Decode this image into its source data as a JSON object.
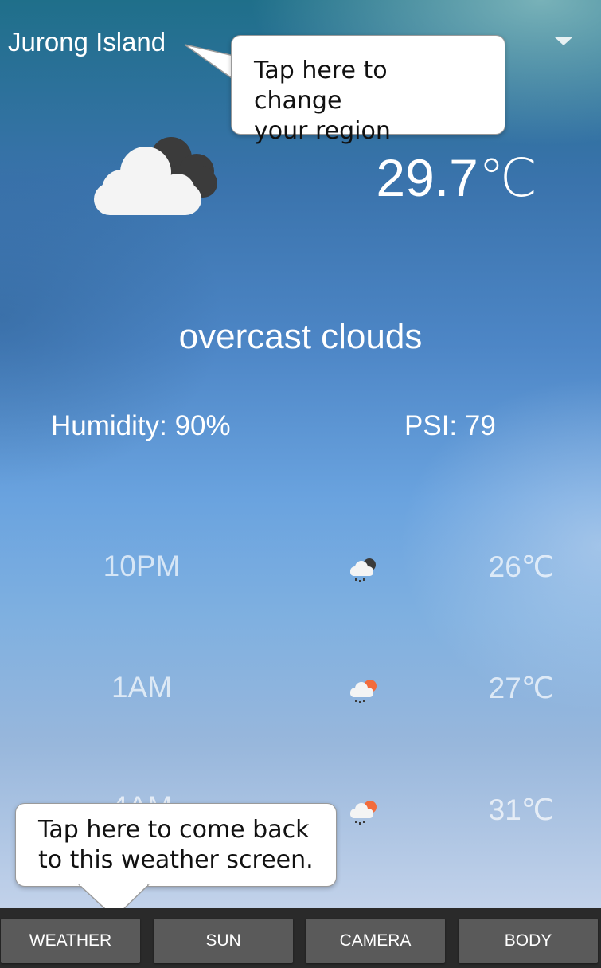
{
  "header": {
    "region": "Jurong Island"
  },
  "current": {
    "icon": "cloud-dark-cloud-icon",
    "temperature": "29.7℃",
    "description": "overcast clouds",
    "humidity": "Humidity: 90%",
    "psi": "PSI: 79"
  },
  "forecast": [
    {
      "time": "10PM",
      "icon": "night-rain-cloud-icon",
      "temp": "26℃"
    },
    {
      "time": "1AM",
      "icon": "sun-rain-cloud-icon",
      "temp": "27℃"
    },
    {
      "time": "4AM",
      "icon": "sun-rain-cloud-icon",
      "temp": "31℃"
    }
  ],
  "tooltips": {
    "region": "Tap here to change\nyour region",
    "weather": "Tap here to come back\nto this weather screen."
  },
  "tabs": [
    "WEATHER",
    "SUN",
    "CAMERA",
    "BODY"
  ],
  "colors": {
    "sun": "#f26c3c",
    "dark_cloud": "#3b3b3b",
    "tab_bg": "#5a5a5a",
    "tabbar_bg": "#2a2a2a"
  }
}
